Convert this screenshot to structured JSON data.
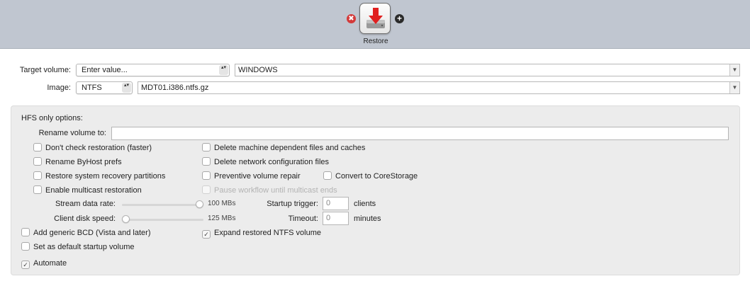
{
  "task": {
    "label": "Restore",
    "icon": "restore-disk-icon",
    "remove_symbol": "✖",
    "add_symbol": "+"
  },
  "target_volume": {
    "label": "Target volume:",
    "select_value": "Enter value...",
    "combo_value": "WINDOWS"
  },
  "image": {
    "label": "Image:",
    "format_value": "NTFS",
    "file_value": "MDT01.i386.ntfs.gz"
  },
  "hfs_options": {
    "heading": "HFS only options:",
    "rename_label": "Rename volume to:",
    "rename_value": "",
    "checkboxes": {
      "dont_check": {
        "label": "Don't check restoration (faster)",
        "checked": false
      },
      "rename_byhost": {
        "label": "Rename ByHost prefs",
        "checked": false
      },
      "restore_recovery": {
        "label": "Restore system recovery partitions",
        "checked": false
      },
      "enable_multicast": {
        "label": "Enable multicast restoration",
        "checked": false
      },
      "delete_machine_files": {
        "label": "Delete machine dependent files and caches",
        "checked": false
      },
      "delete_network_config": {
        "label": "Delete network configuration files",
        "checked": false
      },
      "preventive_repair": {
        "label": "Preventive volume repair",
        "checked": false
      },
      "convert_corestorage": {
        "label": "Convert to CoreStorage",
        "checked": false
      },
      "pause_workflow": {
        "label": "Pause workflow until multicast ends",
        "checked": false,
        "disabled": true
      }
    },
    "stream_rate": {
      "label": "Stream data rate:",
      "value_text": "100 MBs",
      "level": 1.0
    },
    "client_disk_speed": {
      "label": "Client disk speed:",
      "value_text": "125 MBs",
      "level": 0.0
    },
    "startup_trigger": {
      "label": "Startup trigger:",
      "value": "0",
      "unit": "clients"
    },
    "timeout": {
      "label": "Timeout:",
      "value": "0",
      "unit": "minutes"
    }
  },
  "bottom_options": {
    "add_bcd": {
      "label": "Add generic BCD (Vista and later)",
      "checked": false
    },
    "expand_ntfs": {
      "label": "Expand restored NTFS volume",
      "checked": true
    },
    "default_startup": {
      "label": "Set as default startup volume",
      "checked": false
    },
    "automate": {
      "label": "Automate",
      "checked": true
    }
  },
  "symbols": {
    "check": "✓",
    "updown": "▴▾",
    "chevron": "⌄"
  }
}
